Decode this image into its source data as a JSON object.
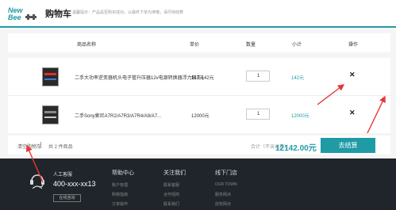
{
  "header": {
    "logo_line1": "New",
    "logo_line2": "Bee",
    "title": "购物车",
    "notice": "温馨提示：产品是否购买成功，以最终下单为准哦，请尽快结算"
  },
  "table": {
    "columns": [
      "商品名称",
      "单价",
      "数量",
      "小计",
      "操作"
    ],
    "rows": [
      {
        "name": "二手大功率逆变器机头电子管升压器12v电源转换器浮力吸王142元",
        "price": "142元",
        "quantity": "1",
        "subtotal": "142元",
        "action_icon": "close-icon"
      },
      {
        "name": "二手Sony索尼A7R2/A7R3/A7R4/A9/A7...",
        "price": "12000元",
        "quantity": "1",
        "subtotal": "12000元",
        "action_icon": "close-icon"
      }
    ]
  },
  "summary": {
    "clear_cart": "清空购物车",
    "count_text": "共 2 件商品",
    "total_label": "合计（不含运费）：",
    "total_amount": "12142.00元",
    "checkout_label": "去结算"
  },
  "footer": {
    "service_label": "人工客服",
    "phone": "400-xxx-xx13",
    "online_button": "在线咨询",
    "columns": [
      {
        "title": "帮助中心",
        "links": [
          "账户管理",
          "购物指南",
          "订单操作"
        ]
      },
      {
        "title": "关注我们",
        "links": [
          "联系客服",
          "合作招商",
          "联系我们"
        ]
      },
      {
        "title": "线下门店",
        "links": [
          "OUR TOWN",
          "服务网点",
          "授权网点"
        ]
      }
    ]
  },
  "colors": {
    "accent": "#1e9ba5",
    "footer_bg": "#1f252b",
    "annotation_arrow": "#e53935"
  }
}
